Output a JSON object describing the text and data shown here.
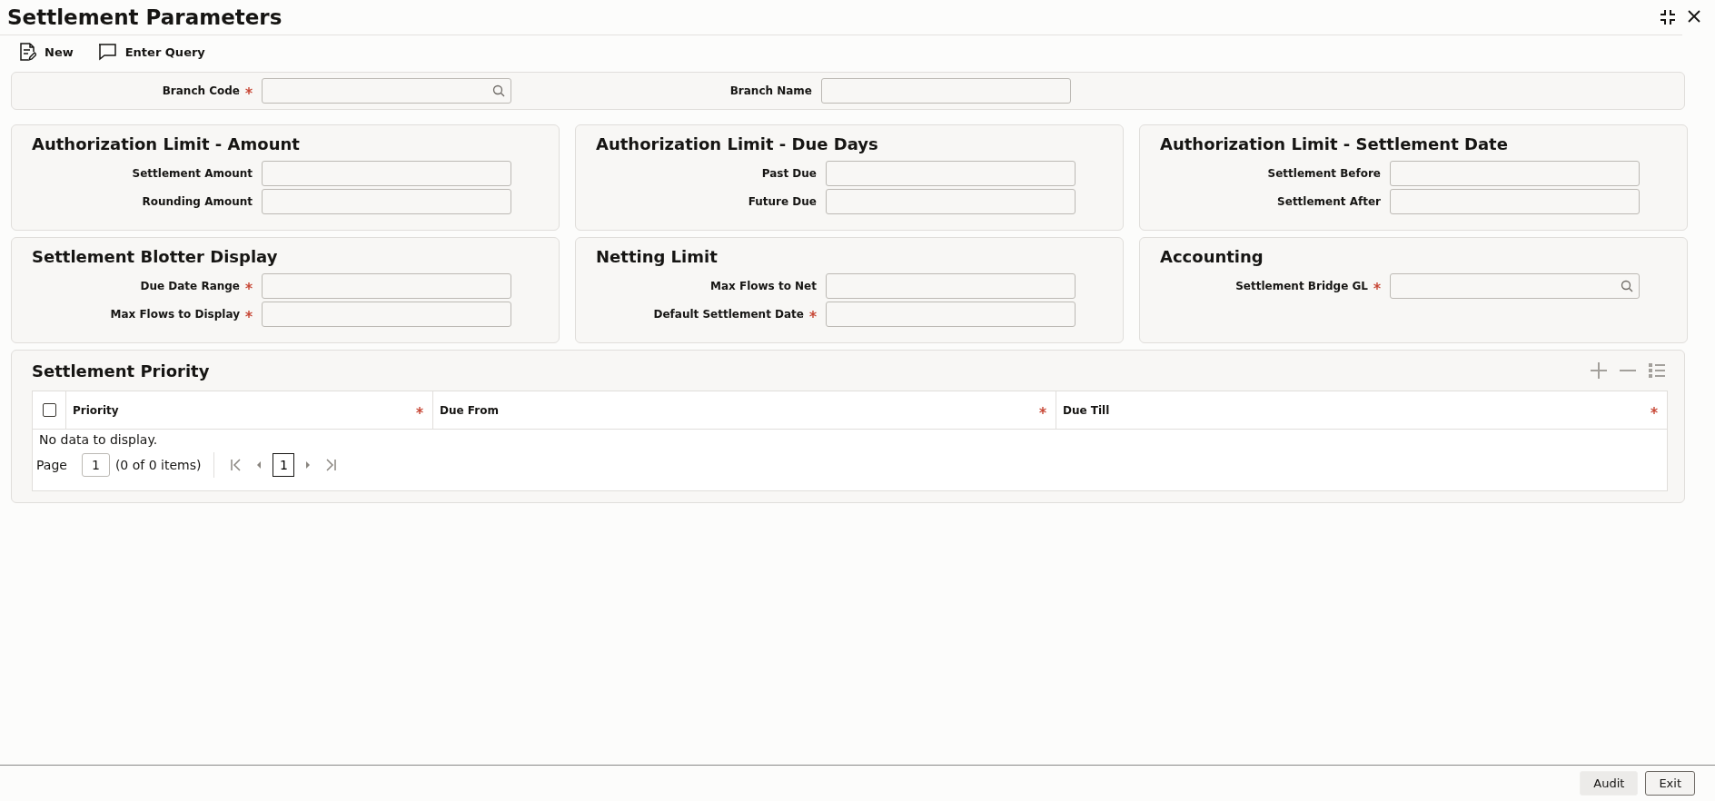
{
  "window": {
    "title": "Settlement Parameters"
  },
  "toolbar": [
    {
      "kind": "new",
      "label": "New"
    },
    {
      "kind": "query",
      "label": "Enter Query"
    }
  ],
  "header_fields": [
    {
      "label": "Branch Code",
      "required": true,
      "kind": "search"
    },
    {
      "label": "Branch Name",
      "required": false,
      "kind": "text"
    }
  ],
  "panels": [
    {
      "title": "Authorization Limit - Amount",
      "fields": [
        {
          "label": "Settlement Amount",
          "required": false,
          "kind": "text"
        },
        {
          "label": "Rounding Amount",
          "required": false,
          "kind": "text"
        }
      ]
    },
    {
      "title": "Authorization Limit - Due Days",
      "fields": [
        {
          "label": "Past Due",
          "required": false,
          "kind": "text"
        },
        {
          "label": "Future Due",
          "required": false,
          "kind": "text"
        }
      ]
    },
    {
      "title": "Authorization Limit - Settlement Date",
      "fields": [
        {
          "label": "Settlement Before",
          "required": false,
          "kind": "text"
        },
        {
          "label": "Settlement After",
          "required": false,
          "kind": "text"
        }
      ]
    },
    {
      "title": "Settlement Blotter Display",
      "fields": [
        {
          "label": "Due Date Range",
          "required": true,
          "kind": "text"
        },
        {
          "label": "Max Flows to Display",
          "required": true,
          "kind": "text"
        }
      ]
    },
    {
      "title": "Netting Limit",
      "fields": [
        {
          "label": "Max Flows to Net",
          "required": false,
          "kind": "text"
        },
        {
          "label": "Default Settlement Date",
          "required": true,
          "kind": "text"
        }
      ]
    },
    {
      "title": "Accounting",
      "fields": [
        {
          "label": "Settlement Bridge GL",
          "required": true,
          "kind": "search"
        }
      ]
    }
  ],
  "priority": {
    "title": "Settlement Priority",
    "select_all": {
      "checked": false
    },
    "columns": [
      {
        "label": "Priority",
        "required": true
      },
      {
        "label": "Due From",
        "required": true
      },
      {
        "label": "Due Till",
        "required": true
      }
    ],
    "empty_message": "No data to display.",
    "pager": {
      "label": "Page",
      "page": "1",
      "summary": "(0 of 0 items)",
      "current": "1"
    }
  },
  "footer": {
    "buttons": [
      {
        "label": "Audit",
        "disabled": true
      },
      {
        "label": "Exit",
        "disabled": false
      }
    ]
  }
}
